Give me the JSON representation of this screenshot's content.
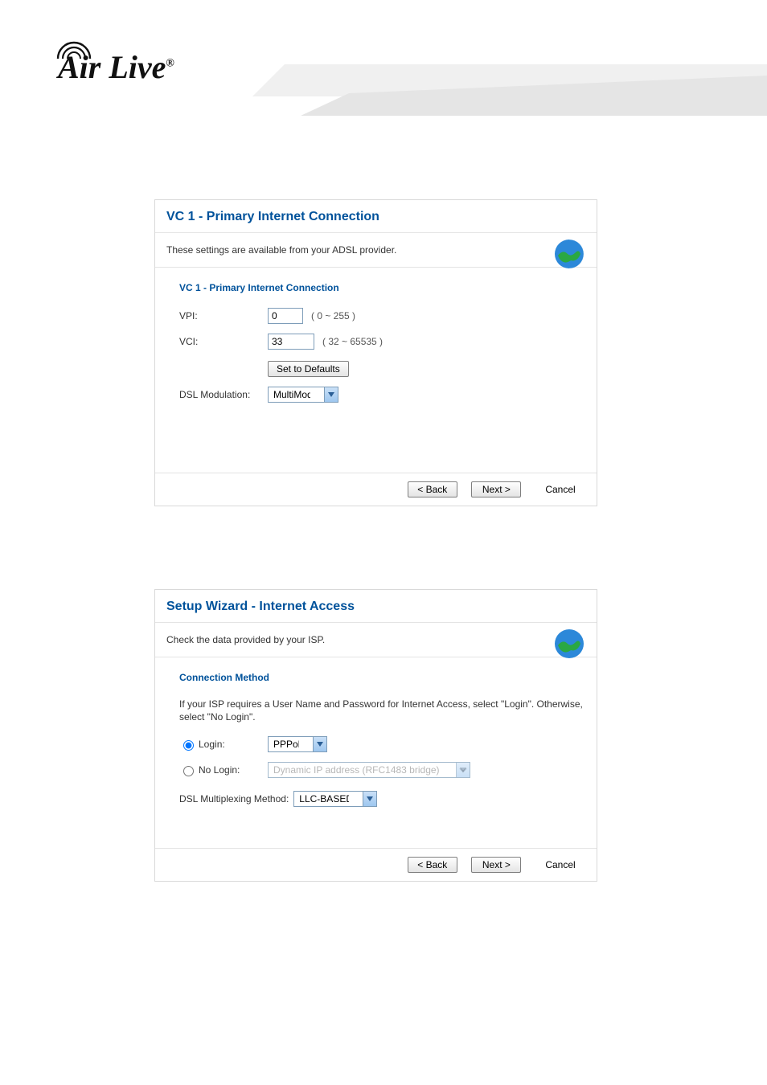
{
  "brand": "Air Live",
  "panel1": {
    "title": "VC 1 - Primary Internet Connection",
    "desc": "These settings are available from your ADSL provider.",
    "sectionHead": "VC 1 - Primary Internet Connection",
    "vpiLabel": "VPI:",
    "vpiValue": "0",
    "vpiHint": "( 0 ~ 255 )",
    "vciLabel": "VCI:",
    "vciValue": "33",
    "vciHint": "( 32 ~ 65535 )",
    "defaultsBtn": "Set to Defaults",
    "dslModLabel": "DSL Modulation:",
    "dslModValue": "MultiMode",
    "back": "< Back",
    "next": "Next >",
    "cancel": "Cancel"
  },
  "panel2": {
    "title": "Setup Wizard - Internet Access",
    "desc": "Check the data provided by your ISP.",
    "sectionHead": "Connection Method",
    "para": "If your ISP requires a User Name and Password for Internet Access, select \"Login\". Otherwise, select \"No Login\".",
    "loginLabel": "Login:",
    "loginValue": "PPPoE",
    "noLoginLabel": "No Login:",
    "noLoginValue": "Dynamic IP address (RFC1483 bridge)",
    "dslMuxLabel": "DSL Multiplexing Method:",
    "dslMuxValue": "LLC-BASED",
    "back": "< Back",
    "next": "Next >",
    "cancel": "Cancel"
  }
}
